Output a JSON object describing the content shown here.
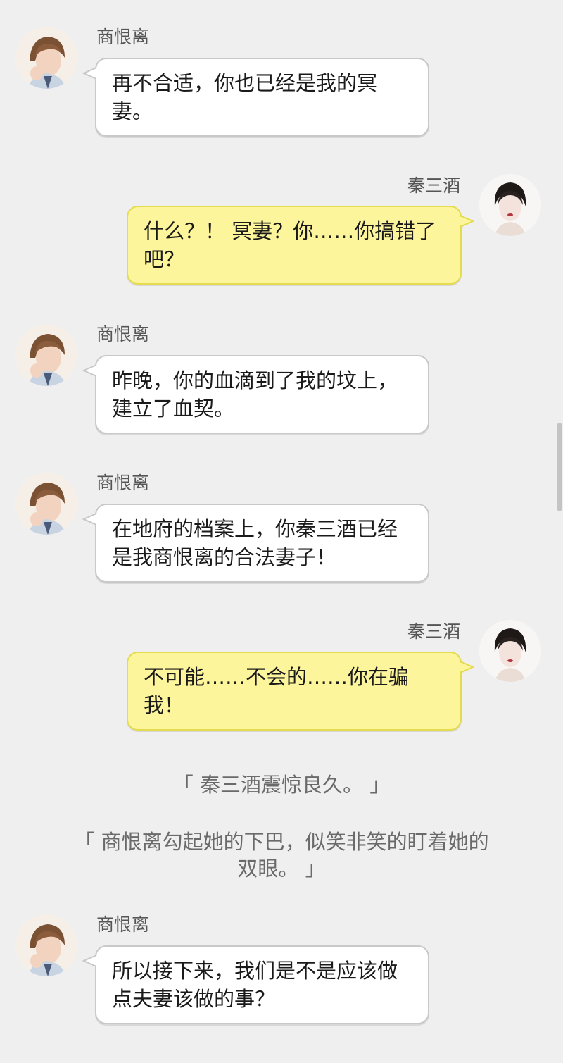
{
  "messages": [
    {
      "speaker": "商恨离",
      "side": "left",
      "text": "再不合适，你也已经是我的冥妻。"
    },
    {
      "speaker": "秦三酒",
      "side": "right",
      "text": "什么？！ 冥妻？你……你搞错了吧？"
    },
    {
      "speaker": "商恨离",
      "side": "left",
      "text": "昨晚，你的血滴到了我的坟上，建立了血契。"
    },
    {
      "speaker": "商恨离",
      "side": "left",
      "text": "在地府的档案上，你秦三酒已经是我商恨离的合法妻子！"
    },
    {
      "speaker": "秦三酒",
      "side": "right",
      "text": "不可能……不会的……你在骗我！"
    },
    {
      "speaker": "商恨离",
      "side": "left",
      "text": "所以接下来，我们是不是应该做点夫妻该做的事？"
    }
  ],
  "narration": [
    "「 秦三酒震惊良久。 」",
    "「 商恨离勾起她的下巴，似笑非笑的盯着她的双眼。 」"
  ],
  "avatars": {
    "left": "male-avatar",
    "right": "female-avatar"
  },
  "colors": {
    "background": "#efefef",
    "left_bubble": "#ffffff",
    "right_bubble": "#fcf59c"
  }
}
